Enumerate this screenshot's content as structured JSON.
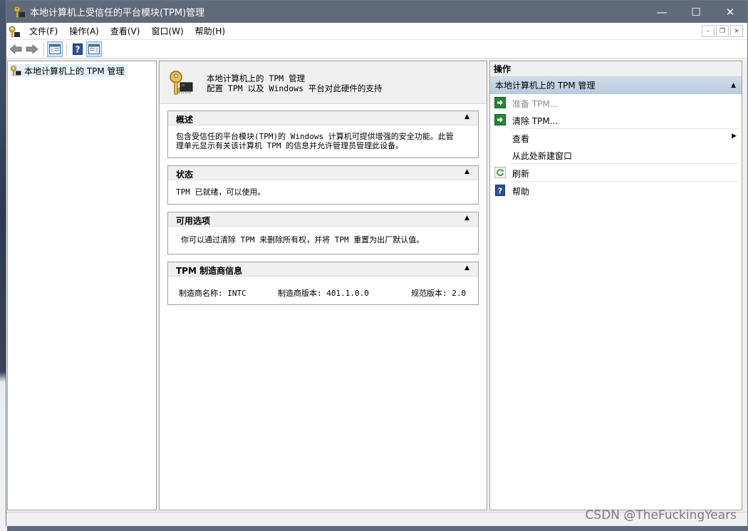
{
  "window": {
    "title": "本地计算机上受信任的平台模块(TPM)管理",
    "controls": {
      "minimize": "—",
      "maximize": "☐",
      "close": "✕"
    }
  },
  "menubar": {
    "items": [
      "文件(F)",
      "操作(A)",
      "查看(V)",
      "窗口(W)",
      "帮助(H)"
    ],
    "mdi": {
      "minimize": "–",
      "restore": "❐",
      "close": "×"
    }
  },
  "toolbar": {
    "icons": [
      "back-arrow-icon",
      "forward-arrow-icon",
      "show-hide-tree-icon",
      "help-icon",
      "show-hide-action-pane-icon"
    ]
  },
  "tree": {
    "root_label": "本地计算机上的 TPM 管理"
  },
  "center": {
    "header_title": "本地计算机上的 TPM 管理",
    "header_subtitle": "配置 TPM 以及 Windows 平台对此硬件的支持",
    "sections": {
      "overview": {
        "title": "概述",
        "line1": "包含受信任的平台模块(TPM)的 Windows 计算机可提供增强的安全功能。此管",
        "line2": "理单元显示有关该计算机 TPM 的信息并允许管理员管理此设备。"
      },
      "status": {
        "title": "状态",
        "text": "TPM 已就绪，可以使用。"
      },
      "options": {
        "title": "可用选项",
        "text": "你可以通过清除 TPM 来删除所有权，并将 TPM 重置为出厂默认值。"
      },
      "vendor": {
        "title": "TPM 制造商信息",
        "name": "制造商名称: INTC",
        "version": "制造商版本: 401.1.0.0",
        "spec": "规范版本: 2.0"
      }
    },
    "toggle_glyph": "▲"
  },
  "actions": {
    "title": "操作",
    "group_label": "本地计算机上的 TPM 管理",
    "items": {
      "prepare": "准备 TPM...",
      "clear": "清除 TPM...",
      "view": "查看",
      "new_window": "从此处新建窗口",
      "refresh": "刷新",
      "help": "帮助"
    },
    "submenu_glyph": "▶"
  },
  "watermark": "CSDN @TheFuckingYears",
  "colors": {
    "titlebar": "#5f6a7a",
    "actions_group": "#c4d3e4",
    "selection": "#e5f1fb",
    "green_action": "#1f8a2e",
    "help_blue": "#2b4fa8"
  }
}
